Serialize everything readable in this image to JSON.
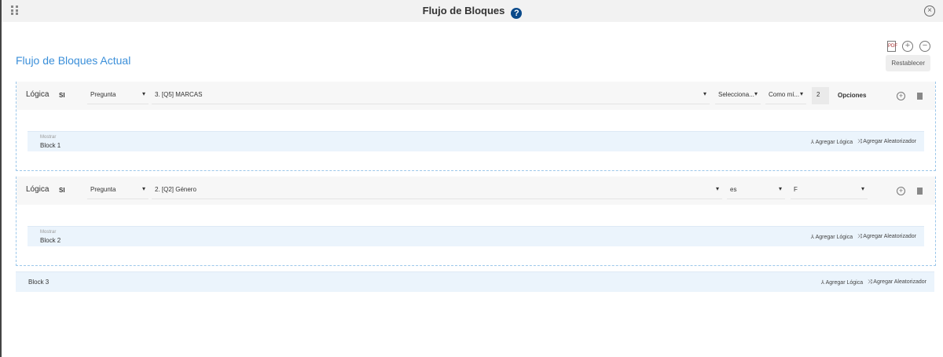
{
  "header": {
    "title": "Flujo de Bloques",
    "help": "?"
  },
  "page_title": "Flujo de Bloques Actual",
  "toolbar": {
    "reset": "Restablecer"
  },
  "logic": [
    {
      "label": "Lógica",
      "cond": "SI",
      "type": "Pregunta",
      "question": "3. [Q5] MARCAS",
      "op": "Selecciona...",
      "qty": "Como mí...",
      "num": "2",
      "options": "Opciones",
      "block": {
        "mostrar": "Mostrar",
        "name": "Block 1"
      }
    },
    {
      "label": "Lógica",
      "cond": "SI",
      "type": "Pregunta",
      "question": "2. [Q2] Género",
      "op": "es",
      "value": "F",
      "block": {
        "mostrar": "Mostrar",
        "name": "Block 2"
      }
    }
  ],
  "block3": {
    "name": "Block 3"
  },
  "actions": {
    "add_logic": "Agregar Lógica",
    "add_random": "Agregar Aleatorizador"
  }
}
